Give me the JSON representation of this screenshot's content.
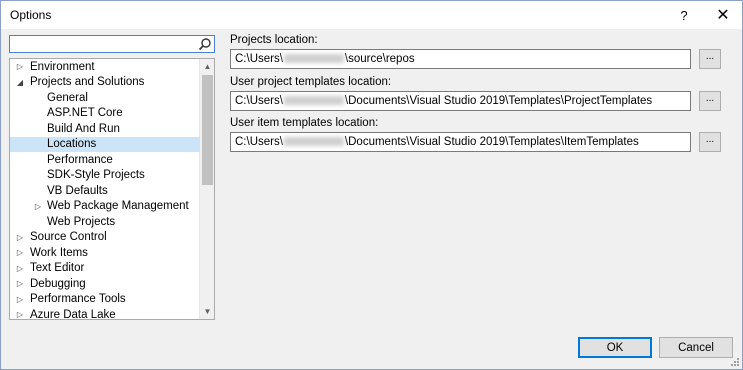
{
  "window": {
    "title": "Options",
    "help_label": "?",
    "close_label": "✕"
  },
  "search": {
    "value": "",
    "placeholder": ""
  },
  "tree": {
    "items": [
      {
        "label": "Environment",
        "arrow": "right"
      },
      {
        "label": "Projects and Solutions",
        "arrow": "down"
      },
      {
        "label": "General",
        "arrow": ""
      },
      {
        "label": "ASP.NET Core",
        "arrow": ""
      },
      {
        "label": "Build And Run",
        "arrow": ""
      },
      {
        "label": "Locations",
        "arrow": "",
        "selected": true
      },
      {
        "label": "Performance",
        "arrow": ""
      },
      {
        "label": "SDK-Style Projects",
        "arrow": ""
      },
      {
        "label": "VB Defaults",
        "arrow": ""
      },
      {
        "label": "Web Package Management",
        "arrow": "right"
      },
      {
        "label": "Web Projects",
        "arrow": ""
      },
      {
        "label": "Source Control",
        "arrow": "right"
      },
      {
        "label": "Work Items",
        "arrow": "right"
      },
      {
        "label": "Text Editor",
        "arrow": "right"
      },
      {
        "label": "Debugging",
        "arrow": "right"
      },
      {
        "label": "Performance Tools",
        "arrow": "right"
      },
      {
        "label": "Azure Data Lake",
        "arrow": "right"
      }
    ]
  },
  "fields": {
    "projects_location": {
      "label": "Projects location:",
      "prefix": "C:\\Users\\",
      "suffix": "\\source\\repos"
    },
    "project_templates": {
      "label": "User project templates location:",
      "prefix": "C:\\Users\\",
      "suffix": "\\Documents\\Visual Studio 2019\\Templates\\ProjectTemplates"
    },
    "item_templates": {
      "label": "User item templates location:",
      "prefix": "C:\\Users\\",
      "suffix": "\\Documents\\Visual Studio 2019\\Templates\\ItemTemplates"
    },
    "browse_label": "..."
  },
  "buttons": {
    "ok": "OK",
    "cancel": "Cancel"
  },
  "colors": {
    "selection": "#cce4f7",
    "accent": "#0078d7"
  }
}
